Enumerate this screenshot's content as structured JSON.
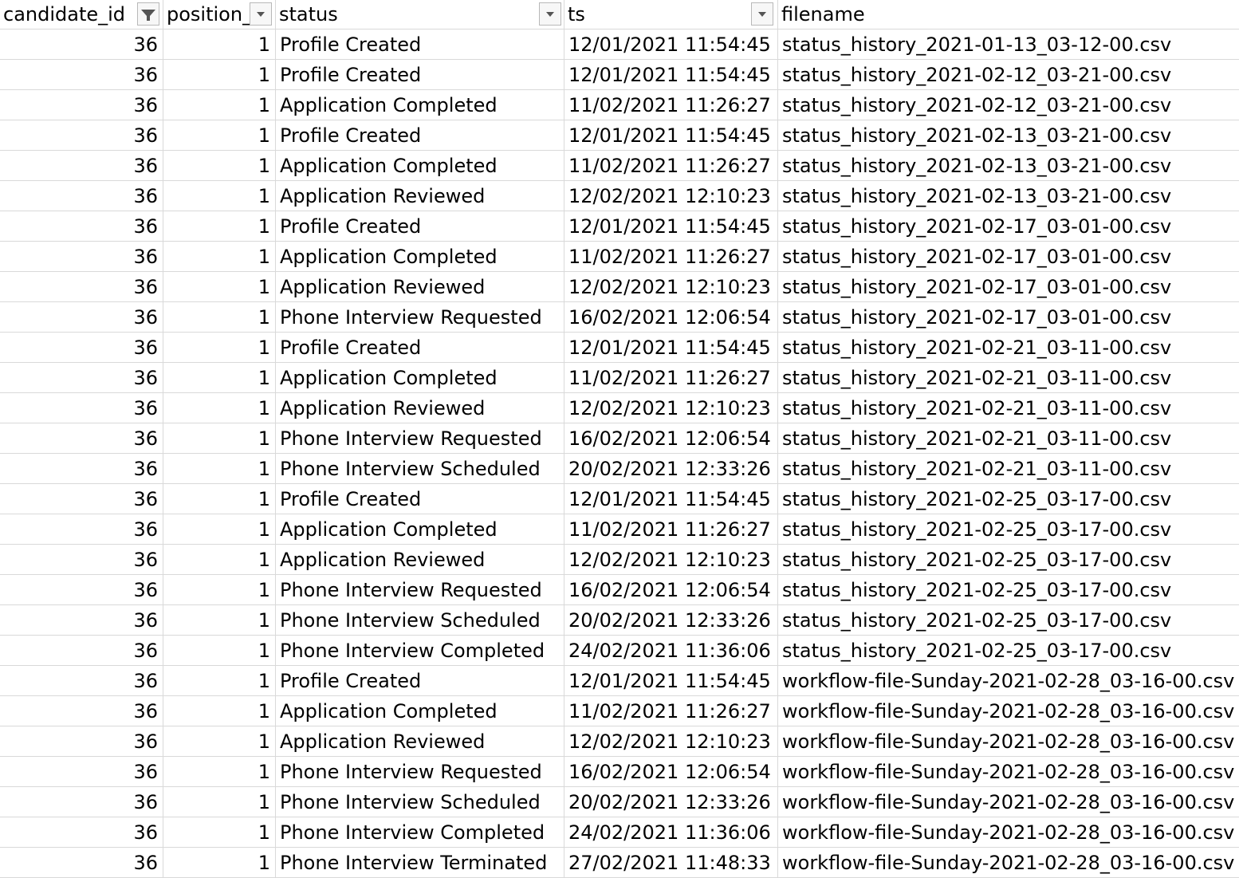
{
  "columns": [
    {
      "label": "candidate_id",
      "filter_icon": "filter-applied-icon"
    },
    {
      "label": "position_",
      "filter_icon": "dropdown-arrow-icon"
    },
    {
      "label": "status",
      "filter_icon": "dropdown-arrow-icon"
    },
    {
      "label": "ts",
      "filter_icon": "dropdown-arrow-icon"
    },
    {
      "label": "filename",
      "filter_icon": ""
    }
  ],
  "rows": [
    {
      "candidate_id": "36",
      "position": "1",
      "status": "Profile Created",
      "ts": "12/01/2021 11:54:45",
      "filename": "status_history_2021-01-13_03-12-00.csv"
    },
    {
      "candidate_id": "36",
      "position": "1",
      "status": "Profile Created",
      "ts": "12/01/2021 11:54:45",
      "filename": "status_history_2021-02-12_03-21-00.csv"
    },
    {
      "candidate_id": "36",
      "position": "1",
      "status": "Application Completed",
      "ts": "11/02/2021 11:26:27",
      "filename": "status_history_2021-02-12_03-21-00.csv"
    },
    {
      "candidate_id": "36",
      "position": "1",
      "status": "Profile Created",
      "ts": "12/01/2021 11:54:45",
      "filename": "status_history_2021-02-13_03-21-00.csv"
    },
    {
      "candidate_id": "36",
      "position": "1",
      "status": "Application Completed",
      "ts": "11/02/2021 11:26:27",
      "filename": "status_history_2021-02-13_03-21-00.csv"
    },
    {
      "candidate_id": "36",
      "position": "1",
      "status": "Application Reviewed",
      "ts": "12/02/2021 12:10:23",
      "filename": "status_history_2021-02-13_03-21-00.csv"
    },
    {
      "candidate_id": "36",
      "position": "1",
      "status": "Profile Created",
      "ts": "12/01/2021 11:54:45",
      "filename": "status_history_2021-02-17_03-01-00.csv"
    },
    {
      "candidate_id": "36",
      "position": "1",
      "status": "Application Completed",
      "ts": "11/02/2021 11:26:27",
      "filename": "status_history_2021-02-17_03-01-00.csv"
    },
    {
      "candidate_id": "36",
      "position": "1",
      "status": "Application Reviewed",
      "ts": "12/02/2021 12:10:23",
      "filename": "status_history_2021-02-17_03-01-00.csv"
    },
    {
      "candidate_id": "36",
      "position": "1",
      "status": "Phone Interview Requested",
      "ts": "16/02/2021 12:06:54",
      "filename": "status_history_2021-02-17_03-01-00.csv"
    },
    {
      "candidate_id": "36",
      "position": "1",
      "status": "Profile Created",
      "ts": "12/01/2021 11:54:45",
      "filename": "status_history_2021-02-21_03-11-00.csv"
    },
    {
      "candidate_id": "36",
      "position": "1",
      "status": "Application Completed",
      "ts": "11/02/2021 11:26:27",
      "filename": "status_history_2021-02-21_03-11-00.csv"
    },
    {
      "candidate_id": "36",
      "position": "1",
      "status": "Application Reviewed",
      "ts": "12/02/2021 12:10:23",
      "filename": "status_history_2021-02-21_03-11-00.csv"
    },
    {
      "candidate_id": "36",
      "position": "1",
      "status": "Phone Interview Requested",
      "ts": "16/02/2021 12:06:54",
      "filename": "status_history_2021-02-21_03-11-00.csv"
    },
    {
      "candidate_id": "36",
      "position": "1",
      "status": "Phone Interview Scheduled",
      "ts": "20/02/2021 12:33:26",
      "filename": "status_history_2021-02-21_03-11-00.csv"
    },
    {
      "candidate_id": "36",
      "position": "1",
      "status": "Profile Created",
      "ts": "12/01/2021 11:54:45",
      "filename": "status_history_2021-02-25_03-17-00.csv"
    },
    {
      "candidate_id": "36",
      "position": "1",
      "status": "Application Completed",
      "ts": "11/02/2021 11:26:27",
      "filename": "status_history_2021-02-25_03-17-00.csv"
    },
    {
      "candidate_id": "36",
      "position": "1",
      "status": "Application Reviewed",
      "ts": "12/02/2021 12:10:23",
      "filename": "status_history_2021-02-25_03-17-00.csv"
    },
    {
      "candidate_id": "36",
      "position": "1",
      "status": "Phone Interview Requested",
      "ts": "16/02/2021 12:06:54",
      "filename": "status_history_2021-02-25_03-17-00.csv"
    },
    {
      "candidate_id": "36",
      "position": "1",
      "status": "Phone Interview Scheduled",
      "ts": "20/02/2021 12:33:26",
      "filename": "status_history_2021-02-25_03-17-00.csv"
    },
    {
      "candidate_id": "36",
      "position": "1",
      "status": "Phone Interview Completed",
      "ts": "24/02/2021 11:36:06",
      "filename": "status_history_2021-02-25_03-17-00.csv"
    },
    {
      "candidate_id": "36",
      "position": "1",
      "status": "Profile Created",
      "ts": "12/01/2021 11:54:45",
      "filename": "workflow-file-Sunday-2021-02-28_03-16-00.csv"
    },
    {
      "candidate_id": "36",
      "position": "1",
      "status": "Application Completed",
      "ts": "11/02/2021 11:26:27",
      "filename": "workflow-file-Sunday-2021-02-28_03-16-00.csv"
    },
    {
      "candidate_id": "36",
      "position": "1",
      "status": "Application Reviewed",
      "ts": "12/02/2021 12:10:23",
      "filename": "workflow-file-Sunday-2021-02-28_03-16-00.csv"
    },
    {
      "candidate_id": "36",
      "position": "1",
      "status": "Phone Interview Requested",
      "ts": "16/02/2021 12:06:54",
      "filename": "workflow-file-Sunday-2021-02-28_03-16-00.csv"
    },
    {
      "candidate_id": "36",
      "position": "1",
      "status": "Phone Interview Scheduled",
      "ts": "20/02/2021 12:33:26",
      "filename": "workflow-file-Sunday-2021-02-28_03-16-00.csv"
    },
    {
      "candidate_id": "36",
      "position": "1",
      "status": "Phone Interview Completed",
      "ts": "24/02/2021 11:36:06",
      "filename": "workflow-file-Sunday-2021-02-28_03-16-00.csv"
    },
    {
      "candidate_id": "36",
      "position": "1",
      "status": "Phone Interview Terminated",
      "ts": "27/02/2021 11:48:33",
      "filename": "workflow-file-Sunday-2021-02-28_03-16-00.csv"
    }
  ]
}
